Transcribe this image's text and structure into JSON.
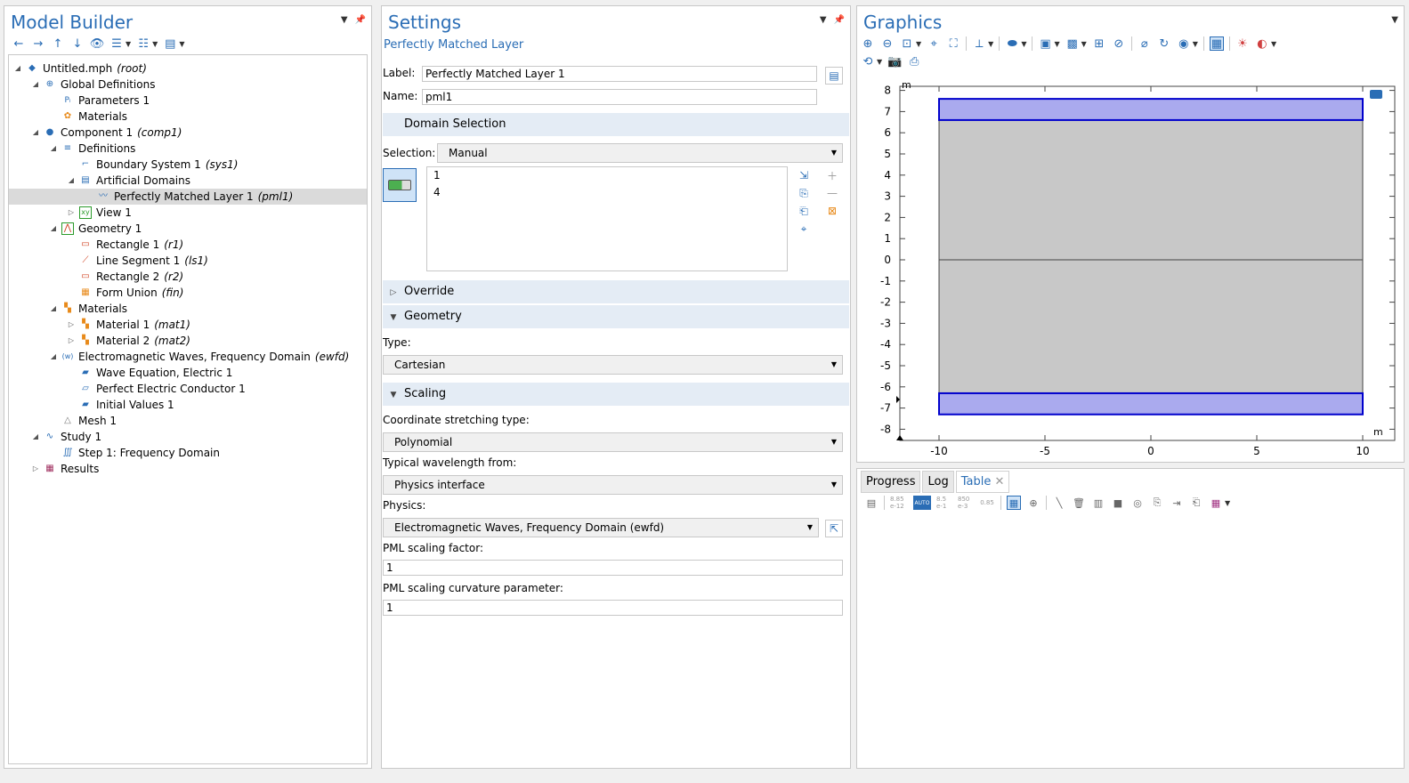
{
  "model_builder": {
    "title": "Model Builder",
    "tree": [
      {
        "label": "Untitled.mph",
        "tag": "(root)"
      },
      {
        "label": "Global Definitions",
        "tag": ""
      },
      {
        "label": "Parameters 1",
        "tag": ""
      },
      {
        "label": "Materials",
        "tag": ""
      },
      {
        "label": "Component 1",
        "tag": "(comp1)"
      },
      {
        "label": "Definitions",
        "tag": ""
      },
      {
        "label": "Boundary System 1",
        "tag": "(sys1)"
      },
      {
        "label": "Artificial Domains",
        "tag": ""
      },
      {
        "label": "Perfectly Matched Layer 1",
        "tag": "(pml1)"
      },
      {
        "label": "View 1",
        "tag": ""
      },
      {
        "label": "Geometry 1",
        "tag": ""
      },
      {
        "label": "Rectangle 1",
        "tag": "(r1)"
      },
      {
        "label": "Line Segment 1",
        "tag": "(ls1)"
      },
      {
        "label": "Rectangle 2",
        "tag": "(r2)"
      },
      {
        "label": "Form Union",
        "tag": "(fin)"
      },
      {
        "label": "Materials",
        "tag": ""
      },
      {
        "label": "Material 1",
        "tag": "(mat1)"
      },
      {
        "label": "Material 2",
        "tag": "(mat2)"
      },
      {
        "label": "Electromagnetic Waves, Frequency Domain",
        "tag": "(ewfd)"
      },
      {
        "label": "Wave Equation, Electric 1",
        "tag": ""
      },
      {
        "label": "Perfect Electric Conductor 1",
        "tag": ""
      },
      {
        "label": "Initial Values 1",
        "tag": ""
      },
      {
        "label": "Mesh 1",
        "tag": ""
      },
      {
        "label": "Study 1",
        "tag": ""
      },
      {
        "label": "Step 1: Frequency Domain",
        "tag": ""
      },
      {
        "label": "Results",
        "tag": ""
      }
    ]
  },
  "settings": {
    "title": "Settings",
    "subtitle": "Perfectly Matched Layer",
    "label_caption": "Label:",
    "label_value": "Perfectly Matched Layer 1",
    "name_caption": "Name:",
    "name_value": "pml1",
    "domain_selection": "Domain Selection",
    "selection_caption": "Selection:",
    "selection_value": "Manual",
    "selected_domains": [
      "1",
      "4"
    ],
    "override": "Override",
    "geometry": "Geometry",
    "type_caption": "Type:",
    "type_value": "Cartesian",
    "scaling": "Scaling",
    "stretch_caption": "Coordinate stretching type:",
    "stretch_value": "Polynomial",
    "wavelength_caption": "Typical wavelength from:",
    "wavelength_value": "Physics interface",
    "physics_caption": "Physics:",
    "physics_value": "Electromagnetic Waves, Frequency Domain (ewfd)",
    "pml_factor_caption": "PML scaling factor:",
    "pml_factor_value": "1",
    "pml_curv_caption": "PML scaling curvature parameter:",
    "pml_curv_value": "1"
  },
  "graphics": {
    "title": "Graphics",
    "unit_top": "m",
    "unit_right": "m",
    "x_ticks": [
      "-10",
      "-5",
      "0",
      "5",
      "10"
    ],
    "y_ticks": [
      "8",
      "7",
      "6",
      "5",
      "4",
      "3",
      "2",
      "1",
      "0",
      "-1",
      "-2",
      "-3",
      "-4",
      "-5",
      "-6",
      "-7",
      "-8"
    ],
    "colors": {
      "domain": "#c8c8c8",
      "pml": "#aaaaee",
      "pml_edge": "#0000cc"
    }
  },
  "bottom": {
    "tabs": [
      "Progress",
      "Log",
      "Table"
    ],
    "active_tab": "Table",
    "num_formats": [
      "8.85 e-12",
      "AUTO",
      "8.5 e-1",
      "850 e-3",
      "0.85"
    ]
  }
}
